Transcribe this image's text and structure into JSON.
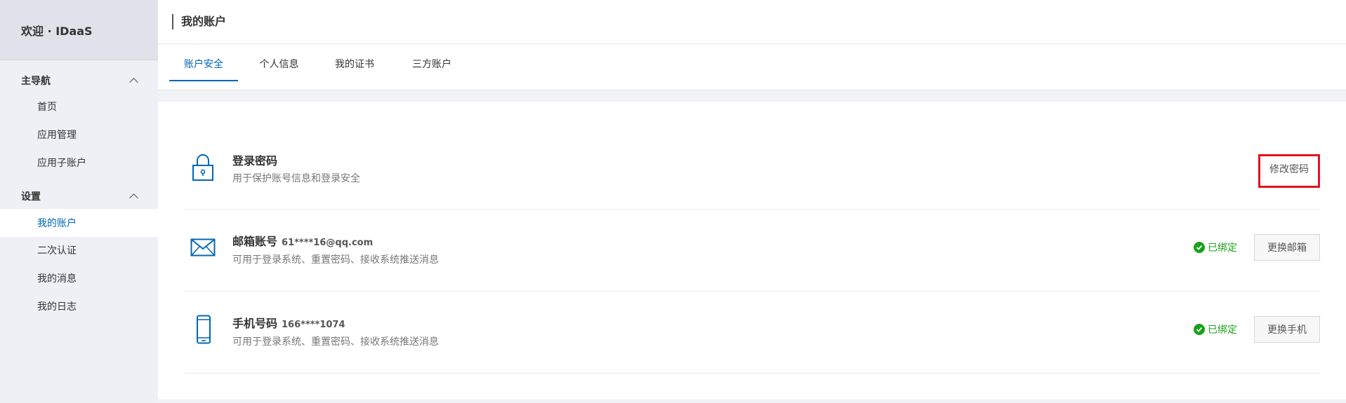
{
  "sidebar": {
    "brand": "欢迎 · IDaaS",
    "groups": [
      {
        "label": "主导航",
        "items": [
          "首页",
          "应用管理",
          "应用子账户"
        ]
      },
      {
        "label": "设置",
        "items": [
          "我的账户",
          "二次认证",
          "我的消息",
          "我的日志"
        ]
      }
    ],
    "active_item": "我的账户"
  },
  "header": {
    "title": "我的账户"
  },
  "tabs": [
    {
      "label": "账户安全",
      "active": true
    },
    {
      "label": "个人信息",
      "active": false
    },
    {
      "label": "我的证书",
      "active": false
    },
    {
      "label": "三方账户",
      "active": false
    }
  ],
  "security": {
    "password": {
      "title": "登录密码",
      "desc": "用于保护账号信息和登录安全",
      "button": "修改密码",
      "icon": "lock-icon"
    },
    "email": {
      "title": "邮箱账号",
      "value": "61****16@qq.com",
      "desc": "可用于登录系统、重置密码、接收系统推送消息",
      "status": "已绑定",
      "button": "更换邮箱",
      "icon": "mail-icon"
    },
    "phone": {
      "title": "手机号码",
      "value": "166****1074",
      "desc": "可用于登录系统、重置密码、接收系统推送消息",
      "status": "已绑定",
      "button": "更换手机",
      "icon": "mobile-phone-icon"
    }
  },
  "colors": {
    "accent": "#0067b8",
    "success": "#1aa11a",
    "highlight": "#e5121e"
  }
}
